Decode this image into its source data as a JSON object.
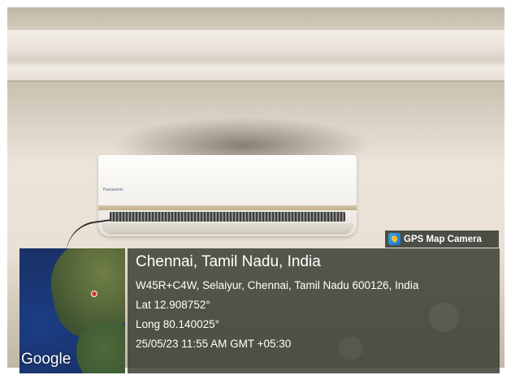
{
  "photo": {
    "subject": "wall-mounted air conditioner",
    "ac_brand_text": "Panasonic"
  },
  "camera_tag": {
    "label": "GPS Map Camera",
    "icon": "gps-map-camera-logo-icon"
  },
  "map": {
    "attribution": "Google"
  },
  "location": {
    "city": "Chennai, Tamil Nadu, India",
    "address": "W45R+C4W, Selaiyur, Chennai, Tamil Nadu 600126, India",
    "lat": "Lat 12.908752°",
    "long": "Long 80.140025°",
    "timestamp": "25/05/23 11:55 AM GMT +05:30"
  }
}
